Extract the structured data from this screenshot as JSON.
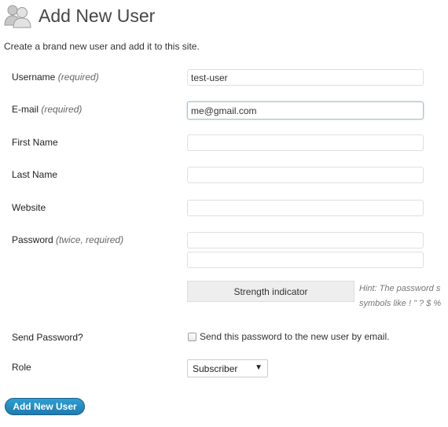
{
  "header": {
    "title": "Add New User",
    "icon": "users-icon"
  },
  "description": "Create a brand new user and add it to this site.",
  "form": {
    "username": {
      "label": "Username",
      "note": "(required)",
      "value": "test-user"
    },
    "email": {
      "label": "E-mail",
      "note": "(required)",
      "value": "me@gmail.com"
    },
    "first_name": {
      "label": "First Name",
      "value": ""
    },
    "last_name": {
      "label": "Last Name",
      "value": ""
    },
    "website": {
      "label": "Website",
      "value": ""
    },
    "password": {
      "label": "Password",
      "note": "(twice, required)",
      "value1": "",
      "value2": ""
    },
    "strength_indicator": "Strength indicator",
    "hint_line1": "Hint: The password s",
    "hint_line2": "symbols like ! \" ? $ %",
    "send_password": {
      "label": "Send Password?",
      "checkbox_label": "Send this password to the new user by email.",
      "checked": false
    },
    "role": {
      "label": "Role",
      "selected": "Subscriber"
    },
    "submit_label": "Add New User"
  },
  "colors": {
    "primary_button": "#2e9fd2",
    "title": "#464646"
  }
}
